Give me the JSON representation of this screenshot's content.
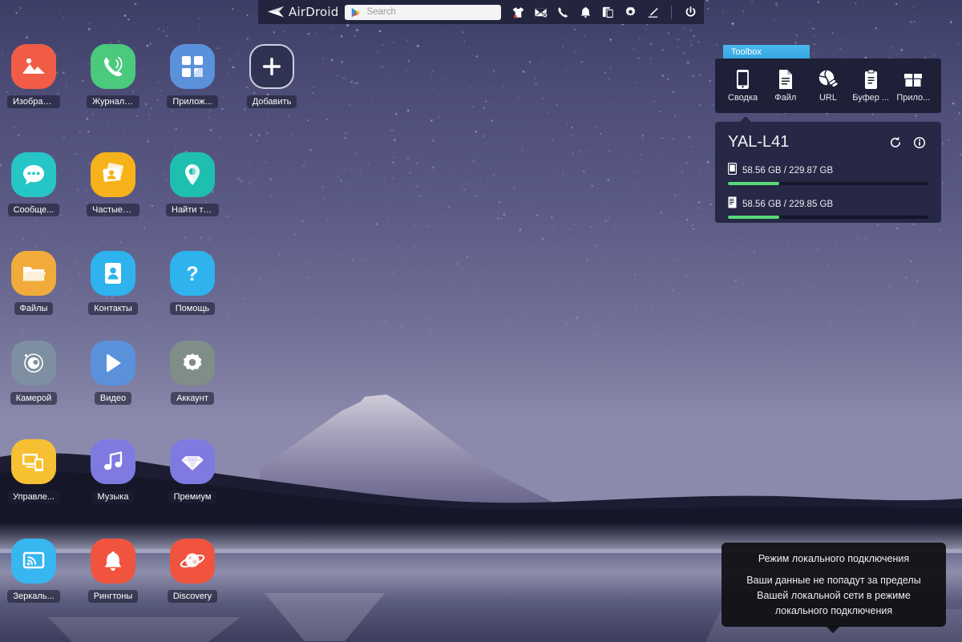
{
  "toolbar": {
    "brand": "AirDroid",
    "search": {
      "placeholder": "Search",
      "value": ""
    },
    "icons": [
      {
        "name": "clothes-icon",
        "title": "Clothes"
      },
      {
        "name": "mail-icon",
        "title": "Mail"
      },
      {
        "name": "phone-icon",
        "title": "Phone"
      },
      {
        "name": "bell-icon",
        "title": "Notifications"
      },
      {
        "name": "screenshot-icon",
        "title": "Screenshot"
      },
      {
        "name": "gear-icon",
        "title": "Settings"
      },
      {
        "name": "pen-icon",
        "title": "Edit"
      },
      {
        "name": "power-icon",
        "title": "Power"
      }
    ]
  },
  "toolbox": {
    "tab_label": "Toolbox",
    "items": [
      {
        "label": "Сводка",
        "icon": "phone-icon"
      },
      {
        "label": "Файл",
        "icon": "file-icon"
      },
      {
        "label": "URL",
        "icon": "globe-link-icon"
      },
      {
        "label": "Буфер ...",
        "icon": "clipboard-icon"
      },
      {
        "label": "Прило...",
        "icon": "package-icon"
      }
    ]
  },
  "device": {
    "name": "YAL-L41",
    "refresh_title": "Обновить",
    "info_title": "Информация",
    "meters": [
      {
        "icon": "phone-storage-icon",
        "text": "58.56 GB / 229.87 GB",
        "percent": 25.5
      },
      {
        "icon": "sd-card-icon",
        "text": "58.56 GB / 229.85 GB",
        "percent": 25.5
      }
    ]
  },
  "tooltip": {
    "title": "Режим локального подключения",
    "body": "Ваши данные не попадут за пределы Вашей локальной сети в режиме локального подключения"
  },
  "desktop": {
    "icons": [
      {
        "label": "Изображ...",
        "icon": "photos-icon",
        "color": "#f05c46",
        "col": 0,
        "row": 0
      },
      {
        "label": "Журнал ...",
        "icon": "call-log-icon",
        "color": "#4bc97c",
        "col": 1,
        "row": 0
      },
      {
        "label": "Прилож...",
        "icon": "apps-icon",
        "color": "#5b91db",
        "col": 2,
        "row": 0
      },
      {
        "label": "Добавить",
        "icon": "add-icon",
        "color": "#313357",
        "col": 3,
        "row": 0
      },
      {
        "label": "Сообще...",
        "icon": "messages-icon",
        "color": "#26c6c6",
        "col": 0,
        "row": 1
      },
      {
        "label": "Частые к...",
        "icon": "contacts-card-icon",
        "color": "#f7b219",
        "col": 1,
        "row": 1
      },
      {
        "label": "Найти те...",
        "icon": "find-phone-icon",
        "color": "#1fbfb0",
        "col": 2,
        "row": 1
      },
      {
        "label": "Файлы",
        "icon": "folder-icon",
        "color": "#f0ab3a",
        "col": 0,
        "row": 2
      },
      {
        "label": "Контакты",
        "icon": "contact-book-icon",
        "color": "#2eb3ee",
        "col": 1,
        "row": 2
      },
      {
        "label": "Помощь",
        "icon": "help-icon",
        "color": "#2eb3ee",
        "col": 2,
        "row": 2
      },
      {
        "label": "Камерой",
        "icon": "camera-icon",
        "color": "#7d8fa0",
        "col": 0,
        "row": 3
      },
      {
        "label": "Видео",
        "icon": "video-icon",
        "color": "#5b91db",
        "col": 1,
        "row": 3
      },
      {
        "label": "Аккаунт",
        "icon": "account-gear-icon",
        "color": "#7f8f88",
        "col": 2,
        "row": 3
      },
      {
        "label": "Управле...",
        "icon": "remote-control-icon",
        "color": "#f7c032",
        "col": 0,
        "row": 4
      },
      {
        "label": "Музыка",
        "icon": "music-icon",
        "color": "#7f7ae0",
        "col": 1,
        "row": 4
      },
      {
        "label": "Премиум",
        "icon": "premium-icon",
        "color": "#7f7ae0",
        "col": 2,
        "row": 4
      },
      {
        "label": "Зеркаль...",
        "icon": "mirror-cast-icon",
        "color": "#37b6f0",
        "col": 0,
        "row": 5
      },
      {
        "label": "Рингтоны",
        "icon": "ringtone-icon",
        "color": "#f0543e",
        "col": 1,
        "row": 5
      },
      {
        "label": "Discovery",
        "icon": "discovery-icon",
        "color": "#f0543e",
        "col": 2,
        "row": 5
      }
    ]
  },
  "colors": {
    "toolbar_bg": "#23243d",
    "panel_bg": "#1e2038",
    "device_panel_bg": "#262845",
    "accent_blue": "#3fb0e8",
    "meter_green": "#59d97a"
  }
}
